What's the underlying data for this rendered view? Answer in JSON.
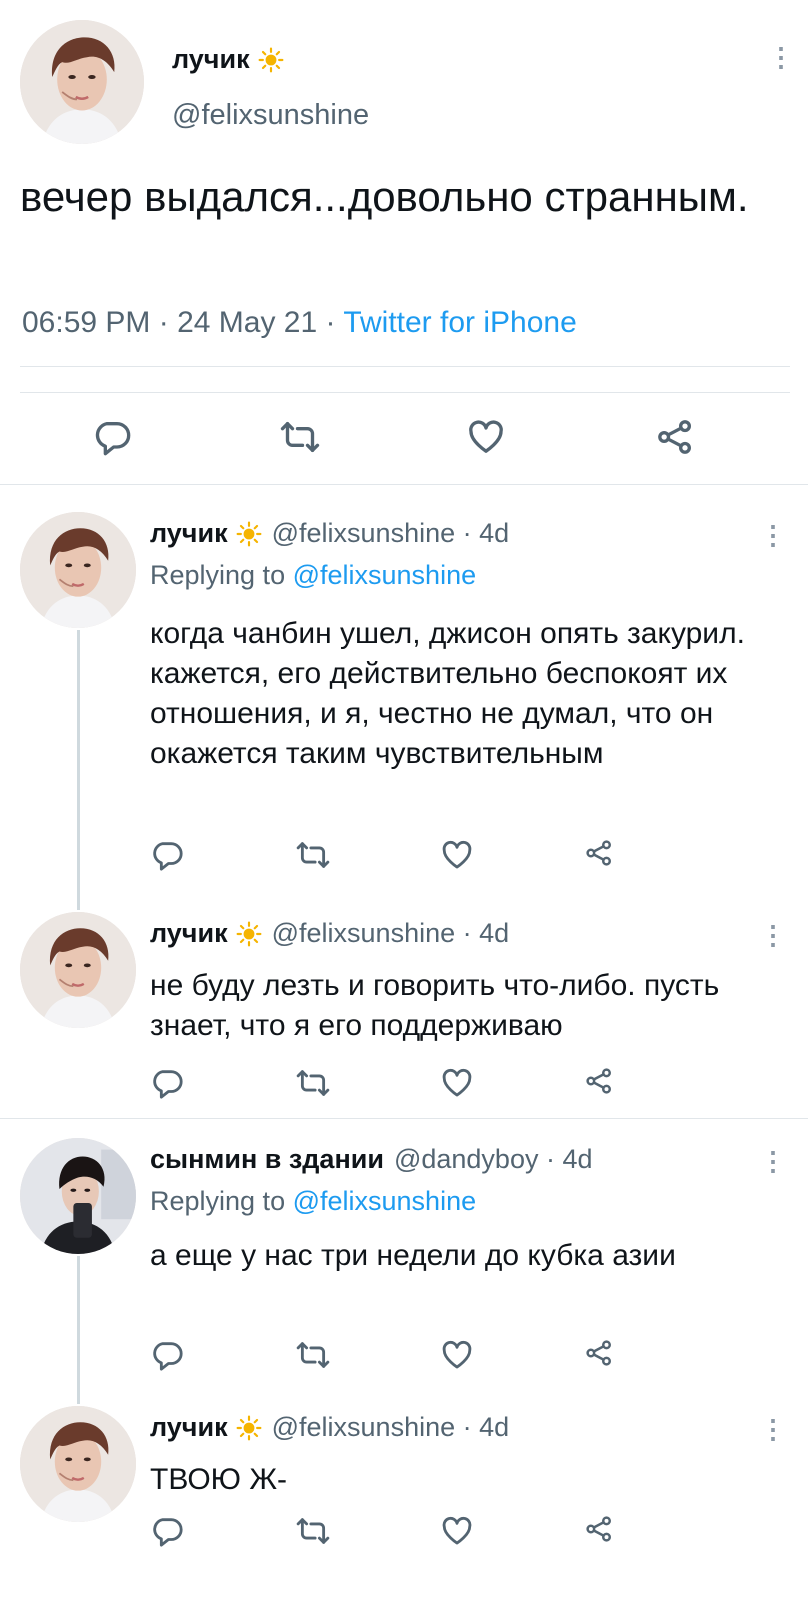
{
  "main": {
    "name": "лучик",
    "handle": "@felixsunshine",
    "text": "вечер выдался...довольно странным.",
    "time": "06:59 PM",
    "date": "24 May 21",
    "source": "Twitter for iPhone",
    "meta_sep": " · "
  },
  "replies": [
    {
      "name": "лучик",
      "handle": "@felixsunshine",
      "age": "4d",
      "replying_prefix": "Replying to ",
      "replying_to": "@felixsunshine",
      "text": "когда чанбин ушел, джисон опять закурил. кажется, его действительно беспокоят их отношения, и я, честно не думал, что он окажется таким чувствительным"
    },
    {
      "name": "лучик",
      "handle": "@felixsunshine",
      "age": "4d",
      "text": "не буду лезть и говорить что-либо. пусть знает, что я его поддерживаю"
    },
    {
      "name": "сынмин в здании",
      "handle": "@dandyboy",
      "age": "4d",
      "replying_prefix": "Replying to ",
      "replying_to": "@felixsunshine",
      "text": "а еще у нас три недели до кубка азии"
    },
    {
      "name": "лучик",
      "handle": "@felixsunshine",
      "age": "4d",
      "text": "ТВОЮ Ж-"
    }
  ],
  "icons": {
    "reply": "reply-icon",
    "retweet": "retweet-icon",
    "like": "like-icon",
    "share": "share-icon",
    "more": "more-icon",
    "sun": "sun-emoji"
  },
  "colors": {
    "accent": "#1d9bf0",
    "muted": "#536471",
    "sun": "#f5b400"
  }
}
